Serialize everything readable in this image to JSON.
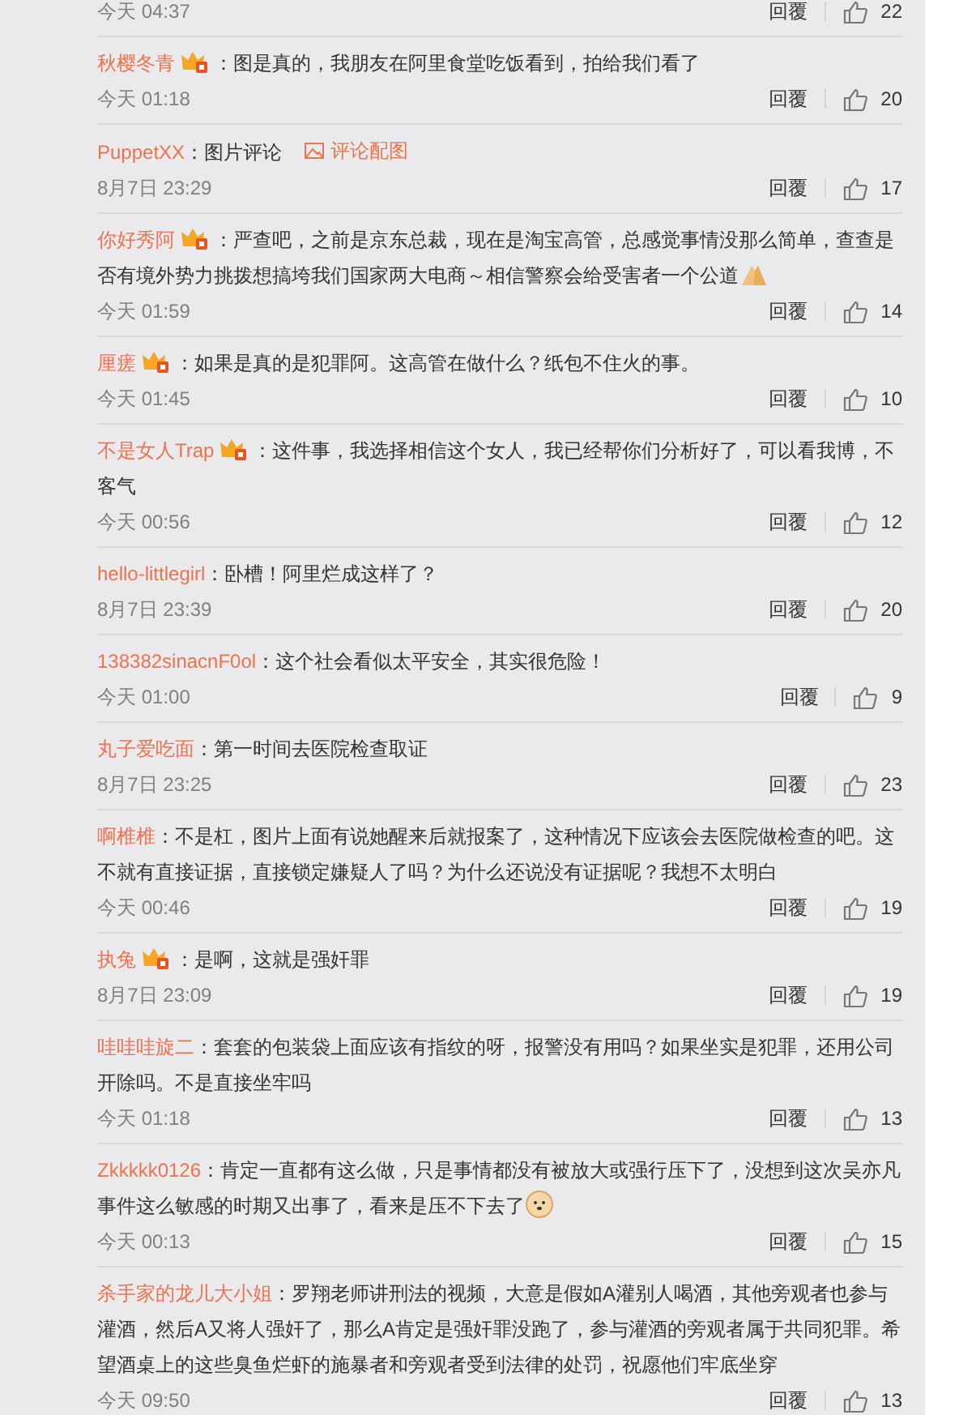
{
  "comments": [
    {
      "time": "今天 04:37",
      "reply": "回覆",
      "likes": "22"
    },
    {
      "user": "秋樱冬青",
      "badge": true,
      "text": "：图是真的，我朋友在阿里食堂吃饭看到，拍给我们看了",
      "time": "今天 01:18",
      "reply": "回覆",
      "likes": "20"
    },
    {
      "user": "PuppetXX",
      "badge": false,
      "text": "：图片评论",
      "image_link": "评论配图",
      "time": "8月7日 23:29",
      "reply": "回覆",
      "likes": "17"
    },
    {
      "user": "你好秀阿",
      "badge": true,
      "text": "：严查吧，之前是京东总裁，现在是淘宝高管，总感觉事情没那么简单，查查是否有境外势力挑拨想搞垮我们国家两大电商～相信警察会给受害者一个公道",
      "emoji": {
        "kind": "hands"
      },
      "time": "今天 01:59",
      "reply": "回覆",
      "likes": "14"
    },
    {
      "user": "厘瘥",
      "badge": true,
      "text": "：如果是真的是犯罪阿。这高管在做什么？纸包不住火的事。",
      "time": "今天 01:45",
      "reply": "回覆",
      "likes": "10"
    },
    {
      "user": "不是女人Trap",
      "badge": true,
      "text": "：这件事，我选择相信这个女人，我已经帮你们分析好了，可以看我博，不客气",
      "time": "今天 00:56",
      "reply": "回覆",
      "likes": "12"
    },
    {
      "user": "hello-littlegirl",
      "badge": false,
      "text": "：卧槽！阿里烂成这样了？",
      "time": "8月7日 23:39",
      "reply": "回覆",
      "likes": "20"
    },
    {
      "user": "138382sinacnF0ol",
      "badge": false,
      "text": "：这个社会看似太平安全，其实很危险！",
      "time": "今天 01:00",
      "reply": "回覆",
      "likes": "9"
    },
    {
      "user": "丸子爱吃面",
      "badge": false,
      "text": "：第一时间去医院检查取证",
      "time": "8月7日 23:25",
      "reply": "回覆",
      "likes": "23"
    },
    {
      "user": "啊椎椎",
      "badge": false,
      "text": "：不是杠，图片上面有说她醒来后就报案了，这种情况下应该会去医院做检查的吧。这不就有直接证据，直接锁定嫌疑人了吗？为什么还说没有证据呢？我想不太明白",
      "time": "今天 00:46",
      "reply": "回覆",
      "likes": "19"
    },
    {
      "user": "执兔",
      "badge": true,
      "text": "：是啊，这就是强奸罪",
      "time": "8月7日 23:09",
      "reply": "回覆",
      "likes": "19"
    },
    {
      "user": "哇哇哇旋二",
      "badge": false,
      "text": "：套套的包装袋上面应该有指纹的呀，报警没有用吗？如果坐实是犯罪，还用公司开除吗。不是直接坐牢吗",
      "time": "今天 01:18",
      "reply": "回覆",
      "likes": "13"
    },
    {
      "user": "Zkkkkk0126",
      "badge": false,
      "text": "：肯定一直都有这么做，只是事情都没有被放大或强行压下了，没想到这次吴亦凡事件这么敏感的时期又出事了，看来是压不下去了",
      "emoji": {
        "kind": "dog"
      },
      "time": "今天 00:13",
      "reply": "回覆",
      "likes": "15"
    },
    {
      "user": "杀手家的龙儿大小姐",
      "badge": false,
      "text": "：罗翔老师讲刑法的视频，大意是假如A灌别人喝酒，其他旁观者也参与灌酒，然后A又将人强奸了，那么A肯定是强奸罪没跑了，参与灌酒的旁观者属于共同犯罪。希望酒桌上的这些臭鱼烂虾的施暴者和旁观者受到法律的处罚，祝愿他们牢底坐穿",
      "time": "今天 09:50",
      "reply": "回覆",
      "likes": "13"
    }
  ]
}
